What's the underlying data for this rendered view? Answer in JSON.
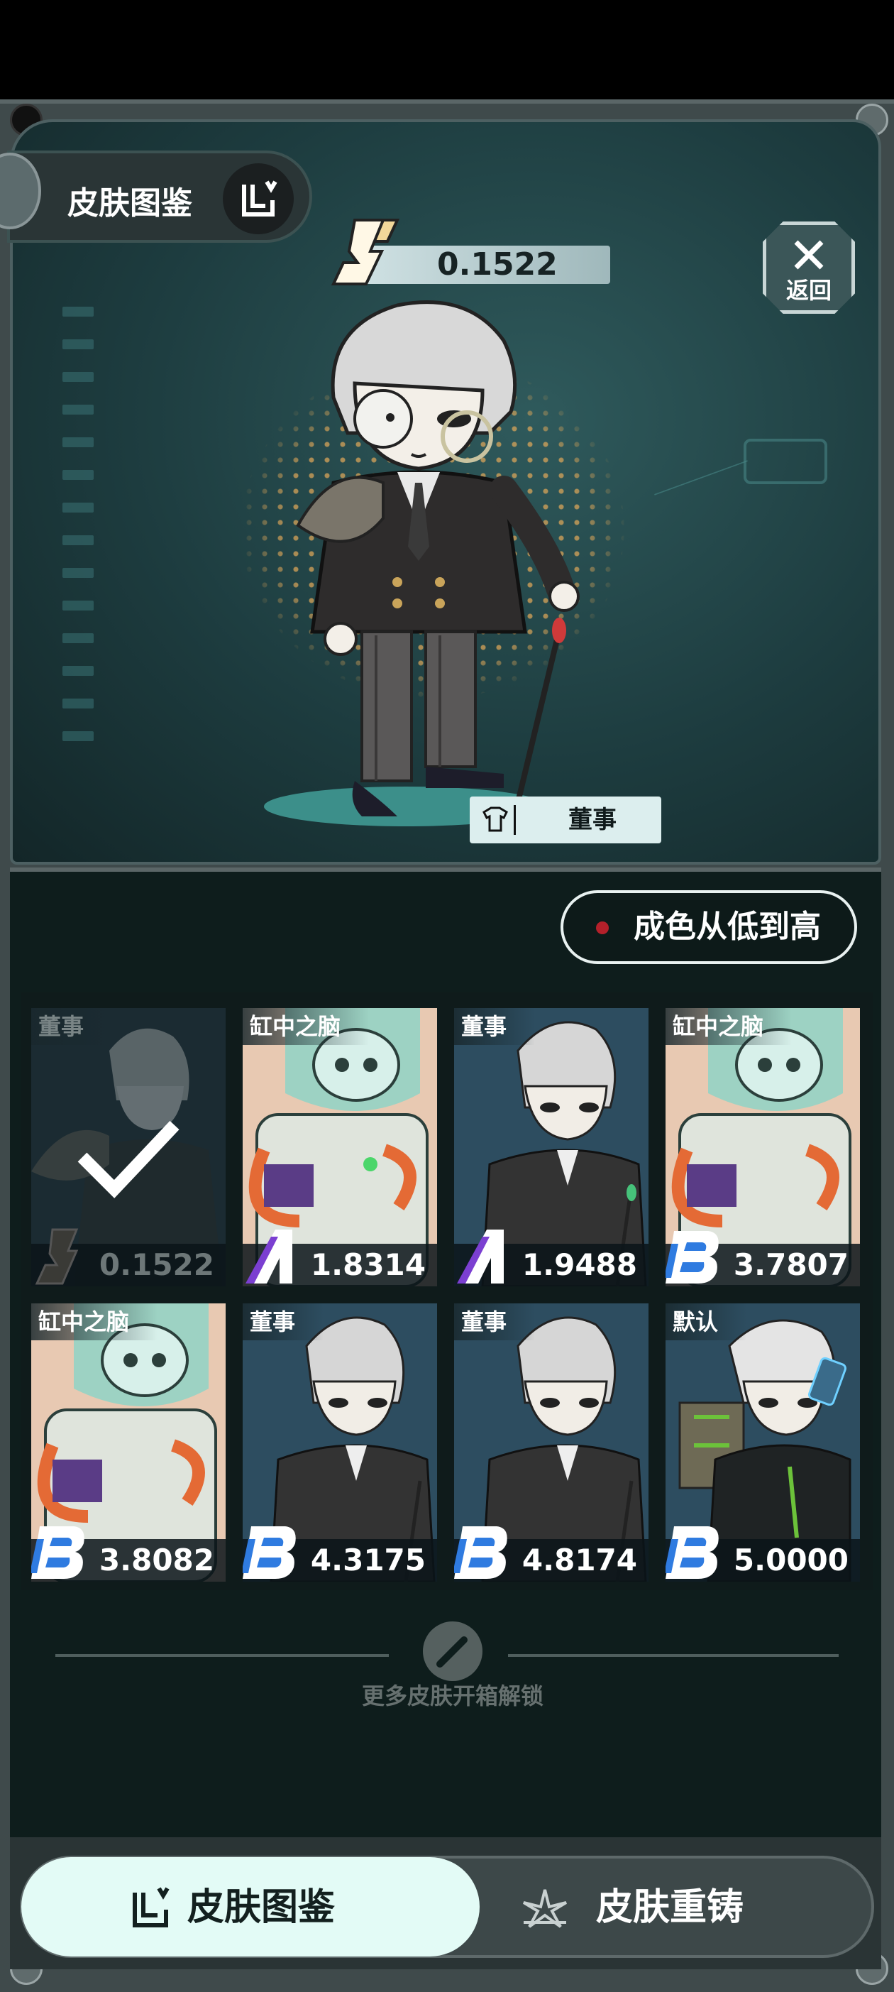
{
  "header": {
    "title": "皮肤图鉴",
    "current_value": "0.1522",
    "back_label": "返回",
    "featured_skin_name": "董事"
  },
  "sort": {
    "label": "成色从低到高"
  },
  "skins": [
    {
      "name": "董事",
      "grade": "S",
      "value": "0.1522",
      "selected": true
    },
    {
      "name": "缸中之脑",
      "grade": "A",
      "value": "1.8314",
      "selected": false
    },
    {
      "name": "董事",
      "grade": "A",
      "value": "1.9488",
      "selected": false
    },
    {
      "name": "缸中之脑",
      "grade": "B",
      "value": "3.7807",
      "selected": false
    },
    {
      "name": "缸中之脑",
      "grade": "B",
      "value": "3.8082",
      "selected": false
    },
    {
      "name": "董事",
      "grade": "B",
      "value": "4.3175",
      "selected": false
    },
    {
      "name": "董事",
      "grade": "B",
      "value": "4.8174",
      "selected": false
    },
    {
      "name": "默认",
      "grade": "B",
      "value": "5.0000",
      "selected": false
    }
  ],
  "unlock_hint": "更多皮肤开箱解锁",
  "tabs": [
    {
      "label": "皮肤图鉴",
      "active": true
    },
    {
      "label": "皮肤重铸",
      "active": false
    }
  ],
  "colors": {
    "grade_S": "#f2d79a",
    "grade_A": "#7b3fd1",
    "grade_B": "#2f7be0",
    "accent_active_tab": "#e3fbf6"
  }
}
